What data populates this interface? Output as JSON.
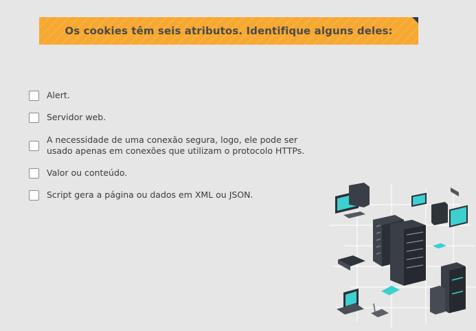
{
  "question": {
    "title": "Os cookies têm seis atributos. Identifique alguns deles:"
  },
  "options": [
    {
      "label": "Alert.",
      "checked": false
    },
    {
      "label": "Servidor web.",
      "checked": false
    },
    {
      "label_line1": "A necessidade de uma conexão segura, logo, ele pode ser",
      "label_line2": "usado apenas em conexões que utilizam o protocolo HTTPs.",
      "checked": false
    },
    {
      "label": "Valor ou conteúdo.",
      "checked": false
    },
    {
      "label": "Script gera a página ou dados em XML ou JSON.",
      "checked": false
    }
  ],
  "illustration": {
    "icon": "network-servers-illustration"
  },
  "colors": {
    "banner": "#f7a830",
    "background": "#e6e6e6",
    "accent": "#3ecfd0"
  }
}
